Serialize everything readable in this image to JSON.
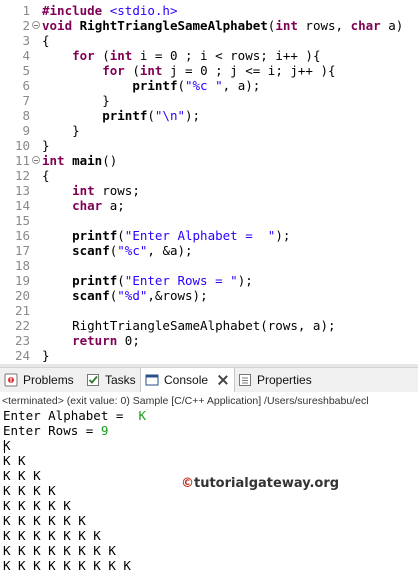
{
  "editor": {
    "lines": [
      {
        "n": "1"
      },
      {
        "n": "2"
      },
      {
        "n": "3"
      },
      {
        "n": "4"
      },
      {
        "n": "5"
      },
      {
        "n": "6"
      },
      {
        "n": "7"
      },
      {
        "n": "8"
      },
      {
        "n": "9"
      },
      {
        "n": "10"
      },
      {
        "n": "11"
      },
      {
        "n": "12"
      },
      {
        "n": "13"
      },
      {
        "n": "14"
      },
      {
        "n": "15"
      },
      {
        "n": "16"
      },
      {
        "n": "17"
      },
      {
        "n": "18"
      },
      {
        "n": "19"
      },
      {
        "n": "20"
      },
      {
        "n": "21"
      },
      {
        "n": "22"
      },
      {
        "n": "23"
      },
      {
        "n": "24"
      }
    ],
    "code": {
      "l1_kw": "#include",
      "l1_str": "<stdio.h>",
      "l2_kw": "void",
      "l2_fn": "RightTriangleSameAlphabet",
      "l2_rest": "(",
      "l2_kw2": "int",
      "l2_rest2": " rows, ",
      "l2_kw3": "char",
      "l2_rest3": " a)",
      "l3": "{",
      "l4_kw": "for",
      "l4_a": " (",
      "l4_kw2": "int",
      "l4_b": " i = 0 ; i < rows; i++ ){",
      "l5_kw": "for",
      "l5_a": " (",
      "l5_kw2": "int",
      "l5_b": " j = 0 ; j <= i; j++ ){",
      "l6_fn": "printf",
      "l6_a": "(",
      "l6_str": "\"%c \"",
      "l6_b": ", a);",
      "l7": "}",
      "l8_fn": "printf",
      "l8_a": "(",
      "l8_str": "\"\\n\"",
      "l8_b": ");",
      "l9": "}",
      "l10": "}",
      "l11_kw": "int",
      "l11_fn": "main",
      "l11_rest": "()",
      "l12": "{",
      "l13_kw": "int",
      "l13_rest": " rows;",
      "l14_kw": "char",
      "l14_rest": " a;",
      "l16_fn": "printf",
      "l16_a": "(",
      "l16_str": "\"Enter Alphabet =  \"",
      "l16_b": ");",
      "l17_fn": "scanf",
      "l17_a": "(",
      "l17_str": "\"%c\"",
      "l17_b": ", &a);",
      "l19_fn": "printf",
      "l19_a": "(",
      "l19_str": "\"Enter Rows = \"",
      "l19_b": ");",
      "l20_fn": "scanf",
      "l20_a": "(",
      "l20_str": "\"%d\"",
      "l20_b": ",&rows);",
      "l22": "RightTriangleSameAlphabet(rows, a);",
      "l23_kw": "return",
      "l23_rest": " 0;",
      "l24": "}"
    }
  },
  "tabs": [
    {
      "label": "Problems",
      "icon": "problems-icon"
    },
    {
      "label": "Tasks",
      "icon": "tasks-icon"
    },
    {
      "label": "Console",
      "icon": "console-icon",
      "active": true
    },
    {
      "label": "Properties",
      "icon": "properties-icon"
    }
  ],
  "console": {
    "terminated": "<terminated> (exit value: 0) Sample [C/C++ Application] /Users/sureshbabu/ecl",
    "prompt1": "Enter Alphabet =  ",
    "input1": "K",
    "prompt2": "Enter Rows = ",
    "input2": "9",
    "output": [
      "K",
      "K K",
      "K K K",
      "K K K K",
      "K K K K K",
      "K K K K K K",
      "K K K K K K K",
      "K K K K K K K K",
      "K K K K K K K K K"
    ]
  },
  "watermark": {
    "copyright": "©",
    "text": "tutorialgateway.org"
  },
  "colors": {
    "keyword": "#7f0055",
    "string": "#2a00ff",
    "input": "#1a9e1a",
    "watermark": "#c0392b"
  }
}
